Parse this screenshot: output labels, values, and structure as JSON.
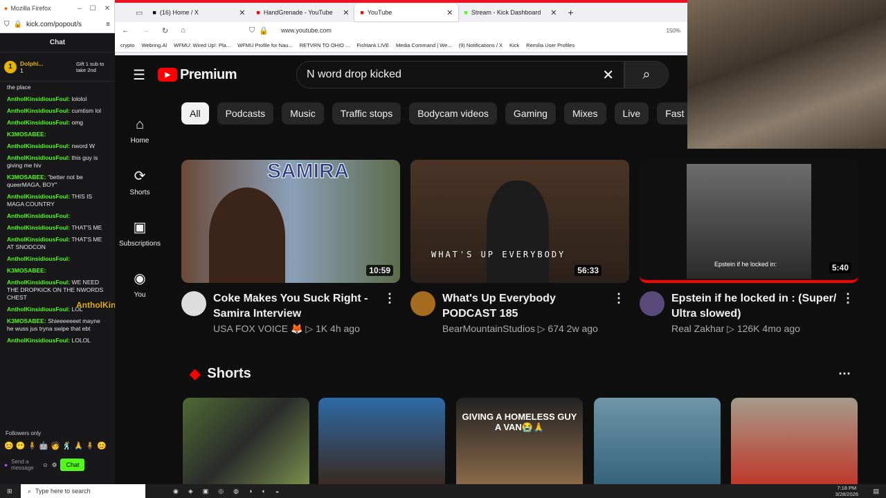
{
  "popout": {
    "title": "Mozilla Firefox",
    "url": "kick.com/popout/s",
    "chat_title": "Chat",
    "gifter_name": "Dolphi...",
    "gifter_count": "1",
    "gift_label": "Gift 1 sub to take 2nd",
    "messages": [
      {
        "user": "",
        "text": "the place"
      },
      {
        "user": "AntholKinsidiousFoul:",
        "text": "lololol"
      },
      {
        "user": "AntholKinsidiousFoul:",
        "text": "cumtism lol"
      },
      {
        "user": "AntholKinsidiousFoul:",
        "text": "omg"
      },
      {
        "user": "K3MOSABEE:",
        "text": ""
      },
      {
        "user": "AntholKinsidiousFoul:",
        "text": "nword W"
      },
      {
        "user": "AntholKinsidiousFoul:",
        "text": "this guy is giving me hiv"
      },
      {
        "user": "K3MOSABEE:",
        "text": "\"better not be queerMAGA, BOY\""
      },
      {
        "user": "AntholKinsidiousFoul:",
        "text": "THIS IS MAGA COUNTRY"
      },
      {
        "user": "AntholKinsidiousFoul:",
        "text": ""
      },
      {
        "user": "AntholKinsidiousFoul:",
        "text": "THAT'S ME"
      },
      {
        "user": "AntholKinsidiousFoul:",
        "text": "THAT'S ME AT SNODCON"
      },
      {
        "user": "AntholKinsidiousFoul:",
        "text": ""
      },
      {
        "user": "K3MOSABEE:",
        "text": ""
      },
      {
        "user": "AntholKinsidiousFoul:",
        "text": "WE NEED THE DROPKICK ON THE NWORDS CHEST"
      },
      {
        "user": "AntholKinsidiousFoul:",
        "text": "LOL"
      },
      {
        "user": "K3MOSABEE:",
        "text": "Shieeeeeeet mayne he wuss jus tryna swipe that ebt"
      },
      {
        "user": "AntholKinsidiousFoul:",
        "text": "LOLOL"
      }
    ],
    "overlay_name": "AntholKinsidiousFoul",
    "followers_only": "Followers only",
    "send_placeholder": "Send a message",
    "chat_button": "Chat"
  },
  "browser": {
    "tabs": [
      {
        "label": "(16) Home / X",
        "color": "#000000"
      },
      {
        "label": "HandGrenade - YouTube",
        "color": "#ff0000"
      },
      {
        "label": "YouTube",
        "color": "#ff0000"
      },
      {
        "label": "Stream - Kick Dashboard",
        "color": "#53fc18"
      }
    ],
    "url": "www.youtube.com",
    "zoom": "150%",
    "bookmarks": [
      "crypto",
      "Webring.Al",
      "WFMU: Wired Up!: Pla...",
      "WFMU Profile for Nau...",
      "RETVRN TO OHIO ...",
      "Fishtank LIVE",
      "Media Command | We...",
      "(9) Notifications / X",
      "Kick",
      "Remilia User Profiles"
    ]
  },
  "youtube": {
    "logo": "Premium",
    "search_value": "N word drop kicked",
    "nav": [
      {
        "label": "Home",
        "icon": "home-icon"
      },
      {
        "label": "Shorts",
        "icon": "shorts-icon"
      },
      {
        "label": "Subscriptions",
        "icon": "subscriptions-icon"
      },
      {
        "label": "You",
        "icon": "you-icon"
      }
    ],
    "chips": [
      "All",
      "Podcasts",
      "Music",
      "Traffic stops",
      "Bodycam videos",
      "Gaming",
      "Mixes",
      "Live",
      "Fast"
    ],
    "videos": [
      {
        "title": "Coke Makes You Suck Right - Samira Interview",
        "channel": "USA FOX VOICE 🦊",
        "views": "1K",
        "age": "4h ago",
        "duration": "10:59",
        "thumb_text": "SAMIRA"
      },
      {
        "title": "What's Up Everybody PODCAST 185",
        "channel": "BearMountainStudios",
        "views": "674",
        "age": "2w ago",
        "duration": "56:33",
        "thumb_text": "WHAT'S UP EVERYBODY"
      },
      {
        "title": "Epstein if he locked in : (Super/ Ultra slowed)",
        "channel": "Real Zakhar",
        "views": "126K",
        "age": "4mo ago",
        "duration": "5:40",
        "thumb_text": "Epstein if he locked in:"
      }
    ],
    "shorts_title": "Shorts",
    "shorts": [
      "",
      "",
      "GIVING A HOMELESS GUY A VAN😭🙏",
      "",
      ""
    ]
  },
  "taskbar": {
    "search_placeholder": "Type here to search",
    "time": "7:18 PM",
    "date": "3/28/2026"
  }
}
